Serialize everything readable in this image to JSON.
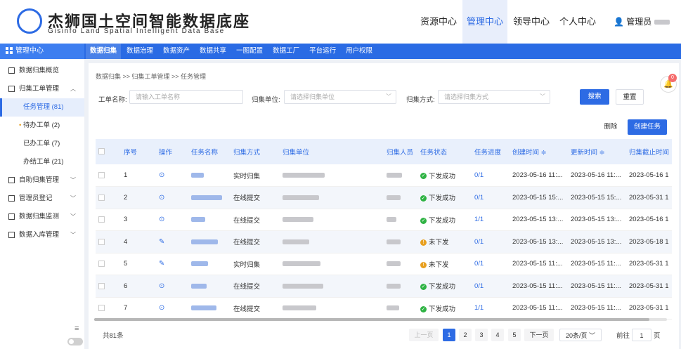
{
  "brand": {
    "cn": "杰狮国土空间智能数据底座",
    "en": "Gisinfo Land Spatial Intelligent Data Base"
  },
  "topnav": [
    "资源中心",
    "管理中心",
    "领导中心",
    "个人中心"
  ],
  "user": {
    "label": "管理员"
  },
  "navbar": {
    "center": "管理中心",
    "tabs": [
      "数据归集",
      "数据治理",
      "数据资产",
      "数据共享",
      "一图配置",
      "数据工厂",
      "平台运行",
      "用户权限"
    ]
  },
  "sidebar": {
    "items": [
      "数据归集概览",
      "归集工单管理",
      "任务管理 (81)",
      "待办工单 (2)",
      "已办工单 (7)",
      "办结工单 (21)",
      "自助归集管理",
      "管理员登记",
      "数据归集监测",
      "数据入库管理"
    ]
  },
  "breadcrumb": "数据归集 >>  归集工单管理 >>  任务管理",
  "filters": {
    "name_label": "工单名称:",
    "name_placeholder": "请输入工单名称",
    "unit_label": "归集单位:",
    "unit_placeholder": "请选择归集单位",
    "mode_label": "归集方式:",
    "mode_placeholder": "请选择归集方式",
    "search": "搜索",
    "reset": "重置"
  },
  "actions": {
    "delete": "删除",
    "create": "创建任务"
  },
  "table": {
    "headers": [
      "序号",
      "操作",
      "任务名称",
      "归集方式",
      "归集单位",
      "归集人员",
      "任务状态",
      "任务进度",
      "创建时间 ≑",
      "更新时间 ≑",
      "归集截止时间"
    ],
    "rows": [
      {
        "no": "1",
        "op": "⊙",
        "mode": "实时归集",
        "status": "下发成功",
        "ok": true,
        "progress": "0/1",
        "created": "2023-05-16 11:...",
        "updated": "2023-05-16 11:...",
        "deadline": "2023-05-16 1"
      },
      {
        "no": "2",
        "op": "⊙",
        "mode": "在线提交",
        "status": "下发成功",
        "ok": true,
        "progress": "0/1",
        "created": "2023-05-15 15:...",
        "updated": "2023-05-15 15:...",
        "deadline": "2023-05-31 1"
      },
      {
        "no": "3",
        "op": "⊙",
        "mode": "在线提交",
        "status": "下发成功",
        "ok": true,
        "progress": "1/1",
        "created": "2023-05-15 13:...",
        "updated": "2023-05-15 13:...",
        "deadline": "2023-05-16 1"
      },
      {
        "no": "4",
        "op": "✎",
        "mode": "在线提交",
        "status": "未下发",
        "ok": false,
        "progress": "0/1",
        "created": "2023-05-15 13:...",
        "updated": "2023-05-15 13:...",
        "deadline": "2023-05-18 1"
      },
      {
        "no": "5",
        "op": "✎",
        "mode": "实时归集",
        "status": "未下发",
        "ok": false,
        "progress": "0/1",
        "created": "2023-05-15 11:...",
        "updated": "2023-05-15 11:...",
        "deadline": "2023-05-31 1"
      },
      {
        "no": "6",
        "op": "⊙",
        "mode": "在线提交",
        "status": "下发成功",
        "ok": true,
        "progress": "0/1",
        "created": "2023-05-15 11:...",
        "updated": "2023-05-15 11:...",
        "deadline": "2023-05-31 1"
      },
      {
        "no": "7",
        "op": "⊙",
        "mode": "在线提交",
        "status": "下发成功",
        "ok": true,
        "progress": "1/1",
        "created": "2023-05-15 11:...",
        "updated": "2023-05-15 11:...",
        "deadline": "2023-05-31 1"
      }
    ]
  },
  "footer": {
    "total": "共81条",
    "prev": "上一页",
    "pages": [
      "1",
      "2",
      "3",
      "4",
      "5"
    ],
    "next": "下一页",
    "size": "20条/页",
    "goto": "前往",
    "goto_value": "1",
    "page_unit": "页"
  },
  "notify": {
    "count": "0"
  },
  "colors": {
    "primary": "#2d6be4",
    "success": "#2fb344",
    "warning": "#e8a020"
  }
}
